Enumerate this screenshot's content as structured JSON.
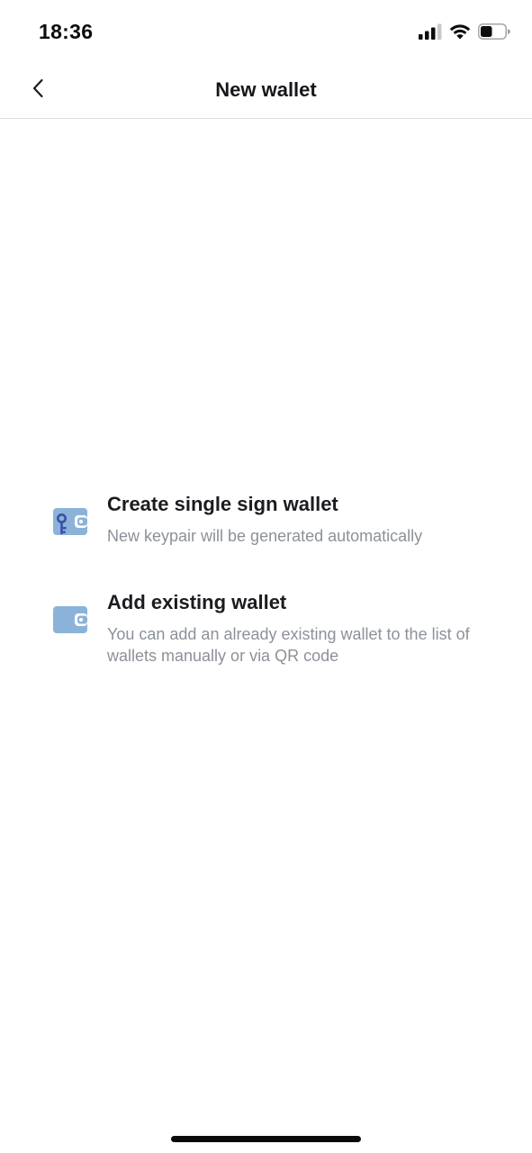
{
  "status_bar": {
    "time": "18:36",
    "icons": [
      "signal-icon",
      "wifi-icon",
      "battery-icon"
    ]
  },
  "nav": {
    "back_icon": "chevron-left-icon",
    "title": "New wallet"
  },
  "options": [
    {
      "icon": "wallet-key-icon",
      "title": "Create single sign wallet",
      "description": "New keypair will be generated automatically"
    },
    {
      "icon": "wallet-icon",
      "title": "Add existing wallet",
      "description": "You can add an already existing wallet to the list of wallets manually or via QR code"
    }
  ],
  "colors": {
    "wallet_icon": "#8bb3d9",
    "key_icon": "#3b4fa8",
    "title_text": "#1b1c1f",
    "secondary_text": "#8c9199",
    "divider": "#dcdde1"
  }
}
